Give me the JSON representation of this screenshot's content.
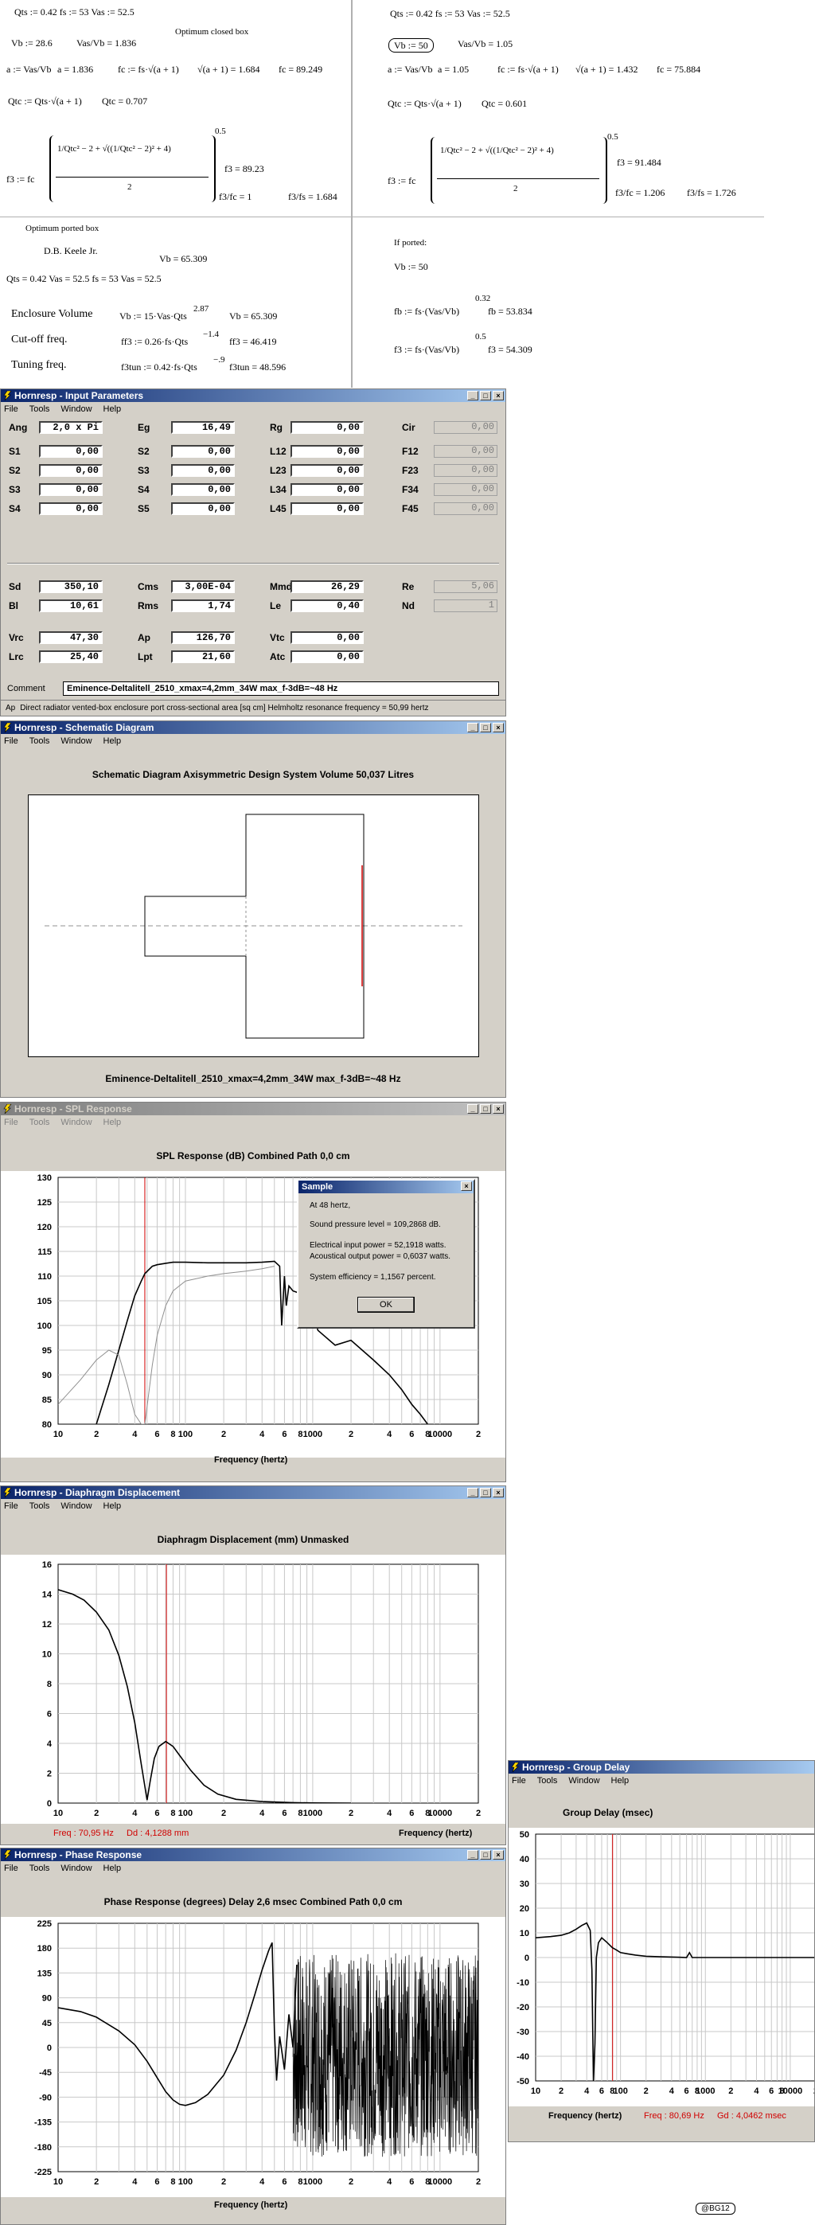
{
  "calc_left": {
    "line1": "Qts := 0.42     fs := 53     Vas := 52.5",
    "vb_line": "Vb := 28.6",
    "vas_vb": "Vas/Vb = 1.836",
    "closed_label": "Optimum closed box",
    "a_def": "a := Vas/Vb",
    "a_val": "a = 1.836",
    "fc_def": "fc := fs·√(a + 1)",
    "sqrt_val": "√(a + 1) = 1.684",
    "fc_val": "fc = 89.249",
    "qtc_def": "Qtc := Qts·√(a + 1)",
    "qtc_val": "Qtc = 0.707",
    "f3_def": "f3 := fc",
    "f3_frac_num": "1/Qtc² − 2 + √((1/Qtc² − 2)² + 4)",
    "f3_frac_den": "2",
    "f3_exp": "0.5",
    "f3_val": "f3 = 89.23",
    "f3_fc": "f3/fc = 1",
    "f3_fs": "f3/fs = 1.684",
    "ported_label": "Optimum ported box",
    "keele": "D.B. Keele Jr.",
    "vb_ported": "Vb = 65.309",
    "line2": "Qts = 0.42     Vas = 52.5     fs = 53     Vas = 52.5",
    "enc_label": "Enclosure Volume",
    "enc_def": "Vb := 15·Vas·Qts",
    "enc_exp": "2.87",
    "enc_val": "Vb = 65.309",
    "cut_label": "Cut-off freq.",
    "cut_def": "ff3 := 0.26·fs·Qts",
    "cut_exp": "−1.4",
    "cut_val": "ff3 = 46.419",
    "tun_label": "Tuning freq.",
    "tun_def": "f3tun := 0.42·fs·Qts",
    "tun_exp": "−.9",
    "tun_val": "f3tun = 48.596"
  },
  "calc_right": {
    "line1": "Qts := 0.42     fs := 53     Vas := 52.5",
    "vb_line": "Vb := 50",
    "vas_vb": "Vas/Vb = 1.05",
    "a_def": "a := Vas/Vb",
    "a_val": "a = 1.05",
    "fc_def": "fc := fs·√(a + 1)",
    "sqrt_val": "√(a + 1) = 1.432",
    "fc_val": "fc = 75.884",
    "qtc_def": "Qtc := Qts·√(a + 1)",
    "qtc_val": "Qtc = 0.601",
    "f3_def": "f3 := fc",
    "f3_frac_num": "1/Qtc² − 2 + √((1/Qtc² − 2)² + 4)",
    "f3_frac_den": "2",
    "f3_exp": "0.5",
    "f3_val": "f3 = 91.484",
    "f3_fc": "f3/fc = 1.206",
    "f3_fs": "f3/fs = 1.726",
    "ported_label": "If ported:",
    "vb_p": "Vb := 50",
    "fb_def": "fb := fs·(Vas/Vb)",
    "fb_exp": "0.32",
    "fb_val": "fb = 53.834",
    "f3p_def": "f3 := fs·(Vas/Vb)",
    "f3p_exp": "0.5",
    "f3p_val": "f3 = 54.309"
  },
  "menu": {
    "file": "File",
    "tools": "Tools",
    "window": "Window",
    "help": "Help"
  },
  "input_win": {
    "title": "Hornresp - Input Parameters",
    "fields": [
      [
        "Ang",
        "2,0 x Pi",
        "Eg",
        "16,49",
        "Rg",
        "0,00",
        "Cir",
        "0,00"
      ],
      [
        "S1",
        "0,00",
        "S2",
        "0,00",
        "L12",
        "0,00",
        "F12",
        "0,00"
      ],
      [
        "S2",
        "0,00",
        "S3",
        "0,00",
        "L23",
        "0,00",
        "F23",
        "0,00"
      ],
      [
        "S3",
        "0,00",
        "S4",
        "0,00",
        "L34",
        "0,00",
        "F34",
        "0,00"
      ],
      [
        "S4",
        "0,00",
        "S5",
        "0,00",
        "L45",
        "0,00",
        "F45",
        "0,00"
      ],
      [
        "Sd",
        "350,10",
        "Cms",
        "3,00E-04",
        "Mmd",
        "26,29",
        "Re",
        "5,06"
      ],
      [
        "Bl",
        "10,61",
        "Rms",
        "1,74",
        "Le",
        "0,40",
        "Nd",
        "1"
      ],
      [
        "Vrc",
        "47,30",
        "Ap",
        "126,70",
        "Vtc",
        "0,00",
        "",
        ""
      ],
      [
        "Lrc",
        "25,40",
        "Lpt",
        "21,60",
        "Atc",
        "0,00",
        "",
        ""
      ]
    ],
    "comment_label": "Comment",
    "comment": "Eminence-Deltalitell_2510_xmax=4,2mm_34W max_f-3dB=~48 Hz",
    "status_ap": "Ap",
    "status": "Direct radiator vented-box enclosure port cross-sectional area  [sq cm]    Helmholtz resonance frequency = 50,99 hertz"
  },
  "schematic_win": {
    "title": "Hornresp - Schematic Diagram",
    "heading": "Schematic Diagram    Axisymmetric Design    System Volume 50,037 Litres",
    "caption": "Eminence-Deltalitell_2510_xmax=4,2mm_34W max_f-3dB=~48 Hz"
  },
  "spl_win": {
    "title": "Hornresp - SPL Response",
    "heading": "SPL Response (dB)    Combined    Path 0,0 cm",
    "xlabel": "Frequency (hertz)"
  },
  "sample_dialog": {
    "title": "Sample",
    "line1": "At 48 hertz,",
    "line2": "Sound pressure level = 109,2868 dB.",
    "line3": "Electrical input power = 52,1918 watts.",
    "line4": "Acoustical output power = 0,6037 watts.",
    "line5": "System efficiency = 1,1567 percent.",
    "ok": "OK"
  },
  "disp_win": {
    "title": "Hornresp - Diaphragm Displacement",
    "heading": "Diaphragm Displacement (mm)    Unmasked",
    "xlabel": "Frequency (hertz)",
    "freq_readout": "Freq : 70,95 Hz",
    "dd_readout": "Dd : 4,1288 mm"
  },
  "phase_win": {
    "title": "Hornresp - Phase Response",
    "heading": "Phase Response (degrees)    Delay 2,6 msec    Combined    Path 0,0 cm",
    "xlabel": "Frequency (hertz)"
  },
  "gd_win": {
    "title": "Hornresp - Group Delay",
    "heading": "Group Delay (msec)",
    "xlabel": "Frequency (hertz)",
    "freq_readout": "Freq : 80,69 Hz",
    "gd_readout": "Gd : 4,0462 msec"
  },
  "watermark": "@BG12",
  "chart_data": [
    {
      "name": "spl",
      "type": "line",
      "title": "SPL Response (dB)    Combined    Path 0,0 cm",
      "xlabel": "Frequency (hertz)",
      "ylabel": "",
      "xscale": "log",
      "xlim": [
        10,
        20000
      ],
      "ylim": [
        80,
        130
      ],
      "yticks": [
        80,
        85,
        90,
        95,
        100,
        105,
        110,
        115,
        120,
        125,
        130
      ],
      "xticklabels": [
        "10",
        "2",
        "4",
        "6",
        "8",
        "100",
        "2",
        "4",
        "6",
        "8",
        "1000",
        "2",
        "4",
        "6",
        "8",
        "10000",
        "2"
      ],
      "marker_x": 48,
      "series": [
        {
          "x": [
            10,
            15,
            20,
            25,
            30,
            35,
            40,
            45,
            48,
            55,
            60,
            70,
            80,
            100,
            150,
            200,
            300,
            400,
            500,
            550,
            570,
            600,
            620,
            650,
            700,
            900,
            1100,
            1500,
            2000,
            3000,
            4000,
            5000,
            6000,
            7000,
            8000
          ],
          "y": [
            50,
            68,
            80,
            88,
            95,
            101,
            106,
            109,
            110.5,
            112,
            112.3,
            112.6,
            112.8,
            112.8,
            112.7,
            112.7,
            112.7,
            112.8,
            113,
            112,
            100,
            110,
            104,
            108,
            107,
            106,
            99,
            96,
            97,
            93,
            90,
            87,
            84,
            82,
            80
          ]
        },
        {
          "x": [
            10,
            15,
            20,
            25,
            30,
            35,
            40,
            45,
            48,
            55,
            60,
            70,
            80,
            100,
            150,
            200,
            300,
            400,
            500
          ],
          "y": [
            84,
            89,
            93,
            95,
            94,
            88,
            82,
            80,
            80,
            92,
            98,
            104,
            107,
            109,
            110,
            110.5,
            111,
            111.5,
            112
          ]
        }
      ]
    },
    {
      "name": "displacement",
      "type": "line",
      "title": "Diaphragm Displacement (mm)    Unmasked",
      "xlabel": "Frequency (hertz)",
      "ylabel": "",
      "xscale": "log",
      "xlim": [
        10,
        20000
      ],
      "ylim": [
        0,
        16
      ],
      "yticks": [
        0,
        2,
        4,
        6,
        8,
        10,
        12,
        14,
        16
      ],
      "xticklabels": [
        "10",
        "2",
        "4",
        "6",
        "8",
        "100",
        "2",
        "4",
        "6",
        "8",
        "1000",
        "2",
        "4",
        "6",
        "8",
        "10000",
        "2"
      ],
      "marker_x": 70.95,
      "series": [
        {
          "x": [
            10,
            13,
            16,
            20,
            25,
            30,
            35,
            40,
            45,
            50,
            53,
            57,
            62,
            70,
            80,
            90,
            110,
            140,
            180,
            250,
            400,
            700,
            1000,
            2000
          ],
          "y": [
            14.3,
            14.0,
            13.6,
            12.8,
            11.6,
            9.9,
            7.8,
            5.4,
            2.6,
            0.2,
            1.5,
            3.0,
            3.8,
            4.13,
            3.8,
            3.2,
            2.2,
            1.2,
            0.6,
            0.25,
            0.1,
            0.03,
            0.01,
            0
          ]
        }
      ]
    },
    {
      "name": "phase",
      "type": "line",
      "title": "Phase Response (degrees)    Delay 2,6 msec    Combined    Path 0,0 cm",
      "xlabel": "Frequency (hertz)",
      "ylabel": "",
      "xscale": "log",
      "xlim": [
        10,
        20000
      ],
      "ylim": [
        -225,
        225
      ],
      "yticks": [
        -225,
        -180,
        -135,
        -90,
        -45,
        0,
        45,
        90,
        135,
        180,
        225
      ],
      "xticklabels": [
        "10",
        "2",
        "4",
        "6",
        "8",
        "100",
        "2",
        "4",
        "6",
        "8",
        "1000",
        "2",
        "4",
        "6",
        "8",
        "10000",
        "2"
      ],
      "series": [
        {
          "x": [
            10,
            15,
            20,
            30,
            40,
            50,
            60,
            70,
            80,
            90,
            100,
            120,
            150,
            200,
            250,
            300,
            350,
            400,
            450,
            480,
            500,
            520,
            550,
            600,
            650,
            700,
            750
          ],
          "y": [
            72,
            65,
            55,
            30,
            5,
            -25,
            -55,
            -80,
            -95,
            -103,
            -105,
            -100,
            -85,
            -50,
            -5,
            45,
            95,
            140,
            175,
            190,
            30,
            -60,
            20,
            -40,
            60,
            0,
            150
          ]
        }
      ]
    },
    {
      "name": "group_delay",
      "type": "line",
      "title": "Group Delay (msec)",
      "xlabel": "Frequency (hertz)",
      "ylabel": "",
      "xscale": "log",
      "xlim": [
        10,
        20000
      ],
      "ylim": [
        -50,
        50
      ],
      "yticks": [
        -50,
        -40,
        -30,
        -20,
        -10,
        0,
        10,
        20,
        30,
        40,
        50
      ],
      "xticklabels": [
        "10",
        "2",
        "4",
        "6",
        "8",
        "100",
        "2",
        "4",
        "6",
        "8",
        "1000",
        "2",
        "4",
        "6",
        "8",
        "10000",
        "2"
      ],
      "marker_x": 80.69,
      "series": [
        {
          "x": [
            10,
            15,
            20,
            25,
            30,
            35,
            40,
            44,
            46,
            48,
            50,
            52,
            55,
            60,
            70,
            80,
            90,
            100,
            120,
            150,
            200,
            300,
            500,
            600,
            650,
            700,
            1000,
            2000,
            5000,
            10000,
            20000
          ],
          "y": [
            8,
            8.5,
            9,
            10,
            11.5,
            13,
            14,
            11,
            -5,
            -50,
            -35,
            0,
            6,
            8,
            6,
            4,
            3,
            2,
            1.5,
            1,
            0.5,
            0.3,
            0.1,
            0,
            2,
            0,
            0,
            0,
            0,
            0,
            0
          ]
        }
      ]
    }
  ]
}
